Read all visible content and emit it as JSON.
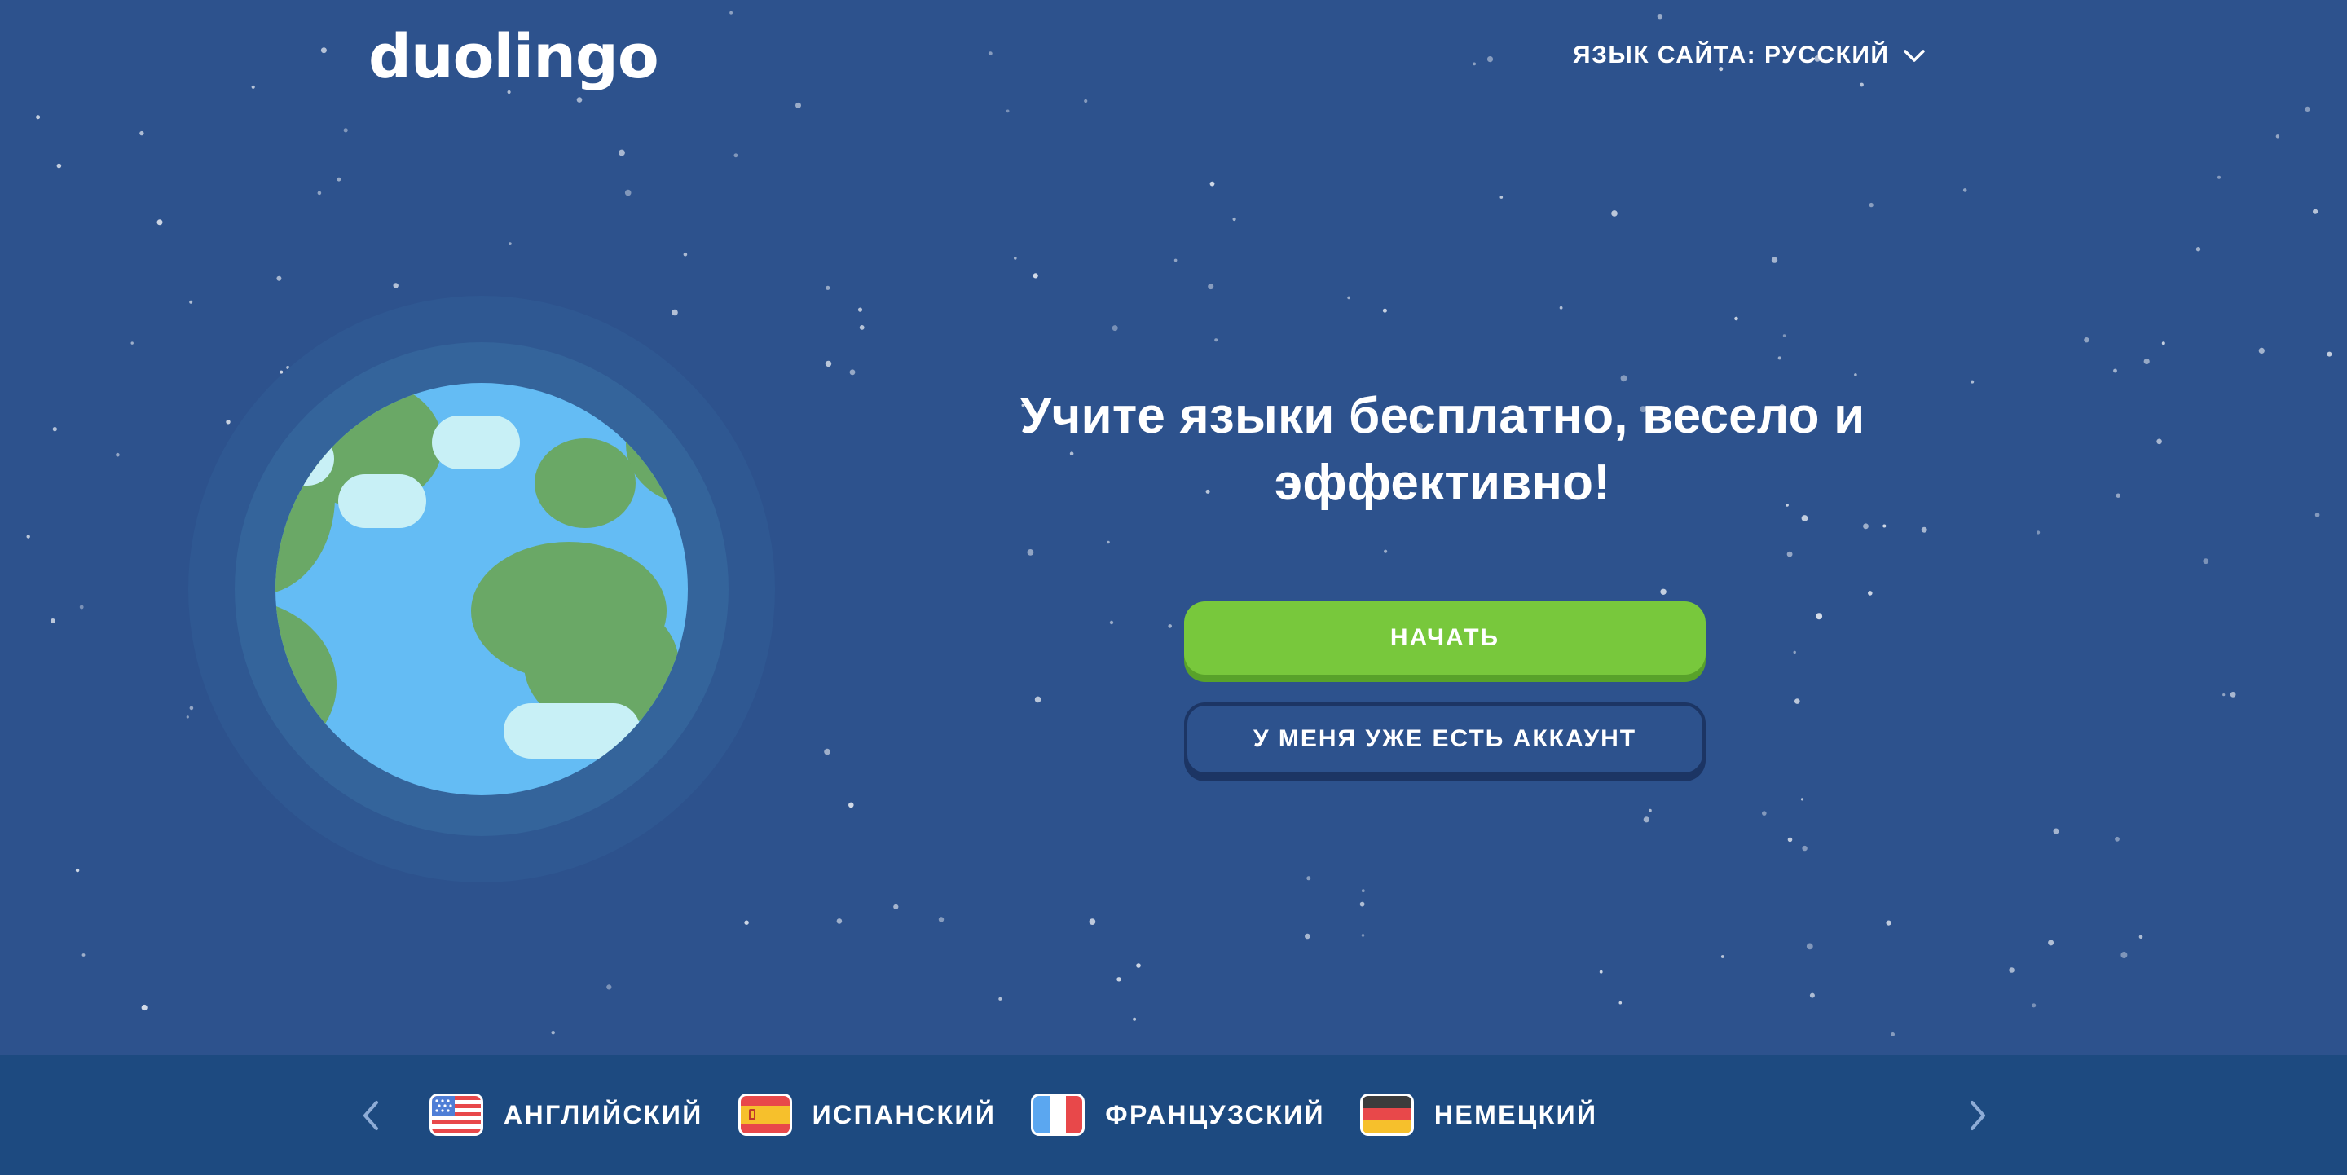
{
  "header": {
    "logo_text": "duolingo",
    "site_language_label": "ЯЗЫК САЙТА: РУССКИЙ"
  },
  "hero": {
    "headline_line1": "Учите языки бесплатно, весело и",
    "headline_line2": "эффективно!",
    "start_button": "НАЧАТЬ",
    "login_button": "У МЕНЯ УЖЕ ЕСТЬ АККАУНТ"
  },
  "languages": [
    {
      "label": "АНГЛИЙСКИЙ",
      "flag": "us-flag-icon"
    },
    {
      "label": "ИСПАНСКИЙ",
      "flag": "spain-flag-icon"
    },
    {
      "label": "ФРАНЦУЗСКИЙ",
      "flag": "france-flag-icon"
    },
    {
      "label": "НЕМЕЦКИЙ",
      "flag": "germany-flag-icon"
    }
  ],
  "colors": {
    "background": "#2d528d",
    "bottom_bar": "#1d4a80",
    "primary_button": "#78c83c",
    "ocean": "#64bcf4",
    "land": "#6aa866",
    "cloud": "#c8f0f6"
  }
}
